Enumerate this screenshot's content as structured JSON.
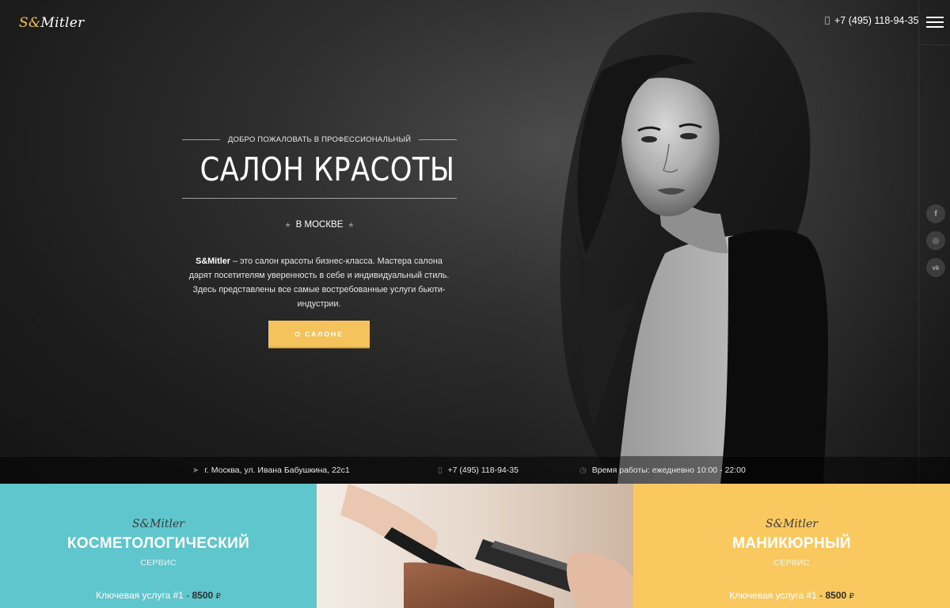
{
  "header": {
    "logo_s": "S",
    "logo_amp": "&",
    "logo_rest": "Mitler",
    "phone": "+7 (495) 118-94-35"
  },
  "hero": {
    "welcome": "ДОБРО ПОЖАЛОВАТЬ В ПРОФЕССИОНАЛЬНЫЙ",
    "title": "САЛОН КРАСОТЫ",
    "city": "В МОСКВЕ",
    "desc_brand": "S&Mitler",
    "desc_text": " – это салон красоты бизнес-класса. Мастера салона дарят посетителям уверенность в себе и индивидуальный стиль. Здесь представлены все самые востребованные услуги бьюти-индустрии.",
    "button": "О САЛОНЕ"
  },
  "social": [
    "f",
    "◎",
    "vk"
  ],
  "infobar": {
    "address": "г. Москва, ул. Ивана Бабушкина, 22с1",
    "phone": "+7 (495) 118-94-35",
    "hours": "Время работы: ежедневно 10:00 - 22:00"
  },
  "cards": {
    "cosmo": {
      "brand": "S&Mitler",
      "title": "КОСМЕТОЛОГИЧЕСКИЙ",
      "sub": "СЕРВИС",
      "key_label": "Ключевая услуга #1",
      "key_dash": " - ",
      "key_price": "8500",
      "currency": "₽"
    },
    "mani": {
      "brand": "S&Mitler",
      "title": "МАНИКЮРНЫЙ",
      "sub": "СЕРВИС",
      "key_label": "Ключевая услуга #1",
      "key_dash": " - ",
      "key_price": "8500",
      "currency": "₽"
    }
  },
  "colors": {
    "accent": "#f5c35c",
    "teal": "#5ec6cc",
    "yellow": "#f9c95f"
  }
}
